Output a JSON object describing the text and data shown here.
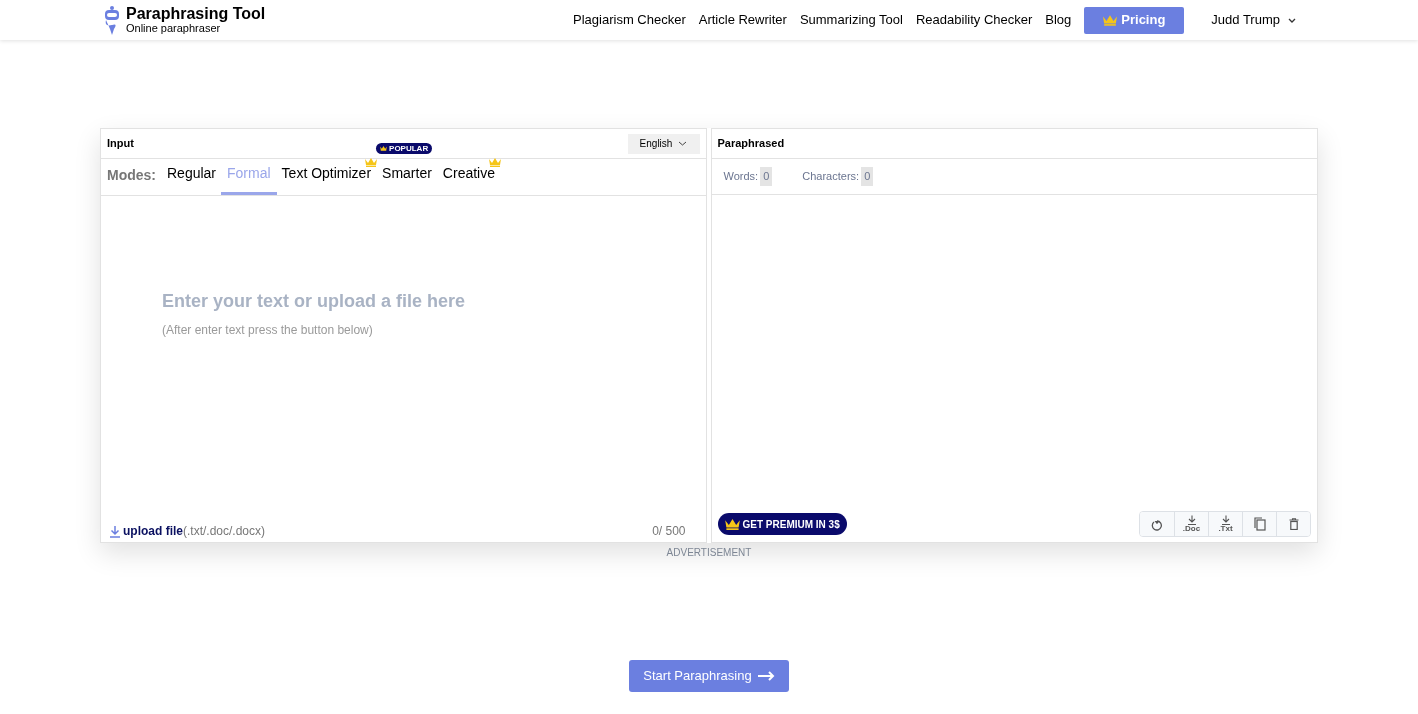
{
  "brand": {
    "title": "Paraphrasing Tool",
    "subtitle": "Online paraphraser"
  },
  "nav": {
    "links": [
      "Plagiarism Checker",
      "Article Rewriter",
      "Summarizing Tool",
      "Readability Checker",
      "Blog"
    ],
    "pricing": "Pricing",
    "user": "Judd Trump"
  },
  "input_panel": {
    "title": "Input",
    "language": "English",
    "modes_label": "Modes:",
    "modes": [
      {
        "label": "Regular",
        "selected": false,
        "premium": false
      },
      {
        "label": "Formal",
        "selected": true,
        "premium": false
      },
      {
        "label": "Text Optimizer",
        "selected": false,
        "premium": true
      },
      {
        "label": "Smarter",
        "selected": false,
        "premium": false,
        "badge": "POPULAR"
      },
      {
        "label": "Creative",
        "selected": false,
        "premium": true
      }
    ],
    "placeholder": "Enter your text or upload a file here",
    "hint": "(After enter text press the button below)",
    "upload_link": "upload file",
    "upload_types": "(.txt/.doc/.docx)",
    "counter": "0/ 500"
  },
  "output_panel": {
    "title": "Paraphrased",
    "stats": [
      {
        "label": "Words:",
        "value": "0"
      },
      {
        "label": "Characters:",
        "value": "0"
      }
    ],
    "premium_button": "GET PREMIUM IN 3$",
    "actions": [
      {
        "kind": "undo"
      },
      {
        "kind": "download",
        "label": ".Doc"
      },
      {
        "kind": "download",
        "label": ".Txt"
      },
      {
        "kind": "copy"
      },
      {
        "kind": "delete"
      }
    ]
  },
  "ad_label": "ADVERTISEMENT",
  "start_button": "Start Paraphrasing"
}
